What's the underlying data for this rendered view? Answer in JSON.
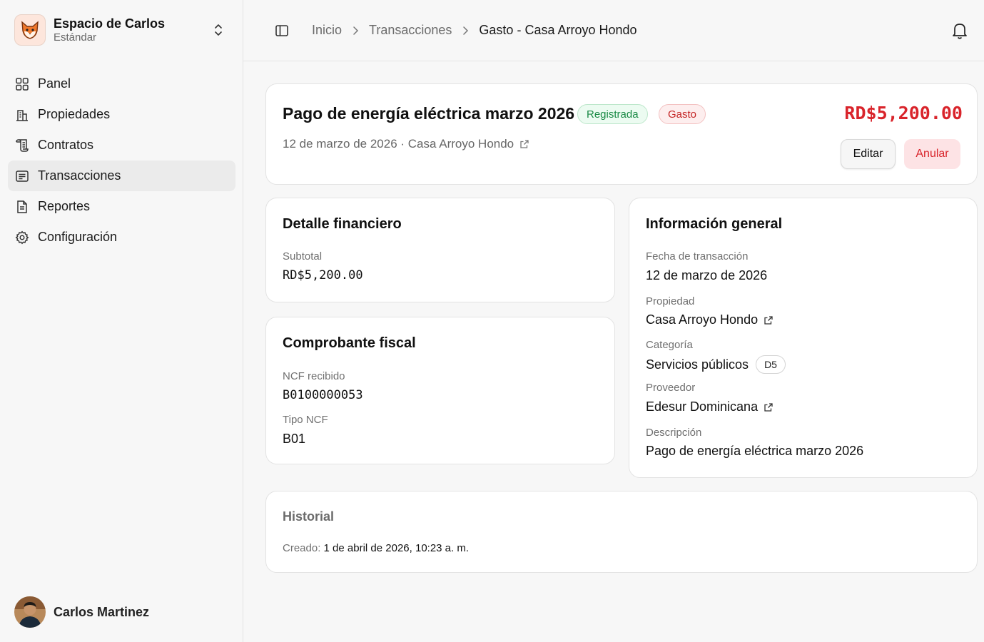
{
  "workspace": {
    "name": "Espacio de Carlos",
    "plan": "Estándar"
  },
  "nav": {
    "items": [
      {
        "label": "Panel",
        "icon": "grid-icon"
      },
      {
        "label": "Propiedades",
        "icon": "building-icon"
      },
      {
        "label": "Contratos",
        "icon": "contract-icon"
      },
      {
        "label": "Transacciones",
        "icon": "receipt-icon",
        "active": true
      },
      {
        "label": "Reportes",
        "icon": "report-icon"
      },
      {
        "label": "Configuración",
        "icon": "gear-icon"
      }
    ]
  },
  "user": {
    "name": "Carlos Martinez"
  },
  "breadcrumb": {
    "home": "Inicio",
    "section": "Transacciones",
    "current": "Gasto - Casa Arroyo Hondo"
  },
  "transaction": {
    "title": "Pago de energía eléctrica marzo 2026",
    "status_badge": "Registrada",
    "type_badge": "Gasto",
    "amount": "RD$5,200.00",
    "subtitle": "12 de marzo de 2026 · Casa Arroyo Hondo",
    "edit_label": "Editar",
    "void_label": "Anular"
  },
  "financial": {
    "title": "Detalle financiero",
    "subtotal_label": "Subtotal",
    "subtotal_value": "RD$5,200.00"
  },
  "fiscal": {
    "title": "Comprobante fiscal",
    "ncf_label": "NCF recibido",
    "ncf_value": "B0100000053",
    "type_label": "Tipo NCF",
    "type_value": "B01"
  },
  "info": {
    "title": "Información general",
    "date_label": "Fecha de transacción",
    "date_value": "12 de marzo de 2026",
    "property_label": "Propiedad",
    "property_value": "Casa Arroyo Hondo",
    "category_label": "Categoría",
    "category_value": "Servicios públicos",
    "category_code": "D5",
    "provider_label": "Proveedor",
    "provider_value": "Edesur Dominicana",
    "description_label": "Descripción",
    "description_value": "Pago de energía eléctrica marzo 2026"
  },
  "history": {
    "title": "Historial",
    "created_label": "Creado:",
    "created_value": "1 de abril de 2026, 10:23 a. m."
  },
  "colors": {
    "danger": "#d9242b",
    "success": "#1a8a45",
    "active_nav": "#ebebeb"
  }
}
